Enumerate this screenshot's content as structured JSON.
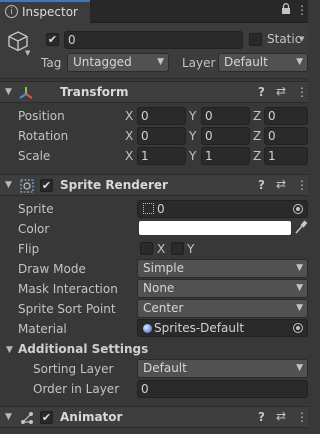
{
  "tab": {
    "title": "Inspector"
  },
  "gameobject": {
    "name": "0",
    "static_label": "Static",
    "tag_label": "Tag",
    "tag_value": "Untagged",
    "layer_label": "Layer",
    "layer_value": "Default"
  },
  "transform": {
    "title": "Transform",
    "rows": [
      {
        "label": "Position",
        "x": "0",
        "y": "0",
        "z": "0"
      },
      {
        "label": "Rotation",
        "x": "0",
        "y": "0",
        "z": "0"
      },
      {
        "label": "Scale",
        "x": "1",
        "y": "1",
        "z": "1"
      }
    ],
    "axis_labels": {
      "x": "X",
      "y": "Y",
      "z": "Z"
    }
  },
  "sprite_renderer": {
    "title": "Sprite Renderer",
    "sprite_label": "Sprite",
    "sprite_value": "0",
    "color_label": "Color",
    "color_value": "#ffffff",
    "flip_label": "Flip",
    "flip_x": "X",
    "flip_y": "Y",
    "draw_mode_label": "Draw Mode",
    "draw_mode_value": "Simple",
    "mask_label": "Mask Interaction",
    "mask_value": "None",
    "sort_point_label": "Sprite Sort Point",
    "sort_point_value": "Center",
    "material_label": "Material",
    "material_value": "Sprites-Default",
    "additional_title": "Additional Settings",
    "sorting_layer_label": "Sorting Layer",
    "sorting_layer_value": "Default",
    "order_label": "Order in Layer",
    "order_value": "0"
  },
  "animator": {
    "title": "Animator"
  },
  "icons": {
    "lock": "🔒",
    "menu": "⋮",
    "help": "?",
    "preset": "⇄",
    "more": "⋮",
    "check": "✔",
    "arrow_down": "▼",
    "arrow_right": "▶"
  }
}
